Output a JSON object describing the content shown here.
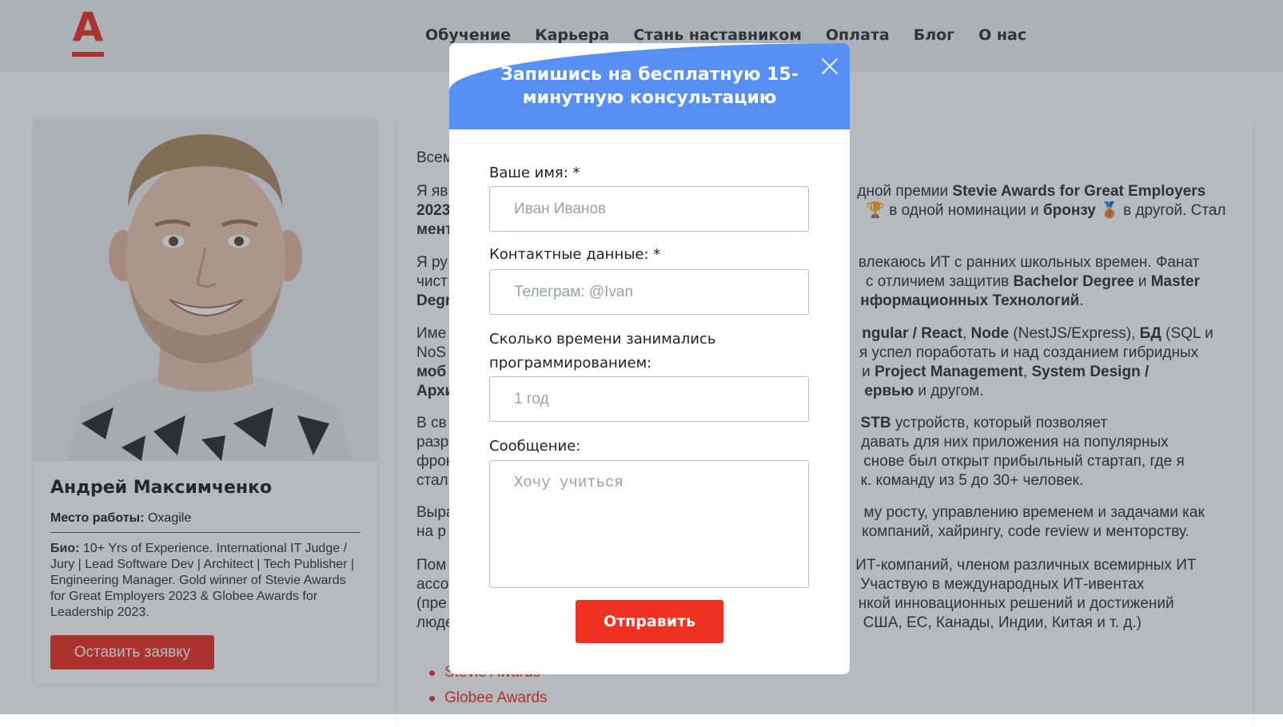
{
  "header": {
    "logo_letter": "А",
    "nav": [
      "Обучение",
      "Карьера",
      "Стань наставником",
      "Оплата",
      "Блог",
      "О нас"
    ]
  },
  "profile": {
    "name": "Андрей Максимченко",
    "workplace_label": "Место работы:",
    "workplace": "Oxagile",
    "bio_label": "Био:",
    "bio": "10+ Yrs of Experience. International IT Judge / Jury | Lead Software Dev | Architect | Tech Publisher | Engineering Manager. Gold winner of Stevie Awards for Great Employers 2023 & Globee Awards for Leadership 2023.",
    "apply_button": "Оставить заявку"
  },
  "main": {
    "p1": "Всем",
    "p2a": "Я яв",
    "p2b": "дной премии ",
    "p2b_bold": "Stevie Awards for Great Employers",
    "p2c": "2023",
    "p2d": " в одной номинации и ",
    "p2d_bold": "бронзу",
    "p2e": " в другой. Стал",
    "p2f": "мент",
    "p3a": "Я ру",
    "p3b": "влекаюсь ИТ с ранних школьных времен. Фанат",
    "p3c": "чист",
    "p3d": " с отличием защитив ",
    "p3d_bold1": "Bachelor Degree",
    "p3d_mid": " и ",
    "p3d_bold2": "Master",
    "p3e": "Degr",
    "p3f": "нформационных Технологий",
    "p4a": "Име",
    "p4b1": "ngular / React",
    "p4b2": "Node",
    "p4b3": " (NestJS/Express), ",
    "p4b4": "БД",
    "p4b5": " (SQL и",
    "p4c": "NoS",
    "p4d": "я успел поработать и над созданием гибридных",
    "p4e": "моб",
    "p4f1": "и ",
    "p4f2": "Project Management",
    "p4f3": "System Design /",
    "p4g": "Архи",
    "p4h1": "ервью",
    "p4h2": " и другом.",
    "p5a": "В св",
    "p5b1": "STB",
    "p5b2": " устройств, который позволяет",
    "p5c": "разр",
    "p5d": "давать для них приложения на популярных",
    "p5e": "фрон",
    "p5f": "снове был открыт прибыльный стартап, где я",
    "p5g": "стал",
    "p5h": "к. команду из 5 до 30+ человек.",
    "p6a": "Выра",
    "p6b": "му росту, управлению временем и задачами как",
    "p6c": "на р",
    "p6d": " компаний, хайрингу, code review и менторству.",
    "p7a": "Пом",
    "p7b": "ИТ-компаний, членом различных всемирных ИТ",
    "p7c": "ассо",
    "p7d": "Участвую в международных ИТ-ивентах",
    "p7e": "(пре",
    "p7f": "нкой инновационных решений и достижений",
    "p7g": "люде",
    "p7h": "США, ЕС, Канады, Индии, Китая и т. д.)",
    "links": [
      "Stevie Awards",
      "Globee Awards"
    ]
  },
  "modal": {
    "title": "Запишись на бесплатную 15-минутную консультацию",
    "name_label": "Ваше имя: *",
    "name_placeholder": "Иван Иванов",
    "contact_label": "Контактные данные: *",
    "contact_placeholder": "Телеграм: @Ivan",
    "experience_label": "Сколько времени занимались программированием:",
    "experience_placeholder": "1 год",
    "message_label": "Сообщение:",
    "message_placeholder": "Хочу учиться",
    "submit": "Отправить",
    "close_icon": "close-icon"
  },
  "colors": {
    "brand_red": "#ef3124",
    "modal_header_blue": "#5790f5",
    "overlay": "rgba(40,52,68,0.34)"
  }
}
